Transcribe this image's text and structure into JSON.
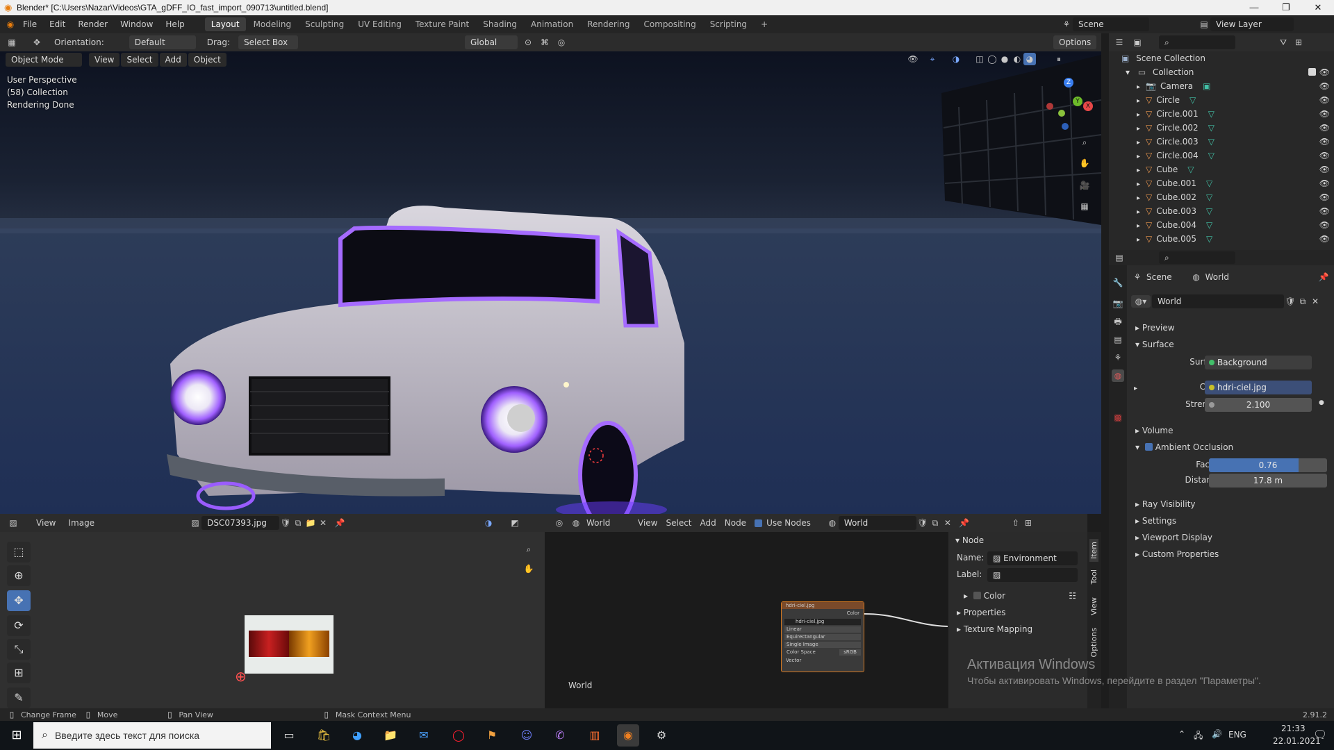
{
  "window": {
    "title": "Blender* [C:\\Users\\Nazar\\Videos\\GTA_gDFF_IO_fast_import_090713\\untitled.blend]",
    "minimize": "—",
    "maximize": "❐",
    "close": "✕"
  },
  "menu": [
    "File",
    "Edit",
    "Render",
    "Window",
    "Help"
  ],
  "workspaces": [
    "Layout",
    "Modeling",
    "Sculpting",
    "UV Editing",
    "Texture Paint",
    "Shading",
    "Animation",
    "Rendering",
    "Compositing",
    "Scripting"
  ],
  "active_workspace": "Layout",
  "scene_name": "Scene",
  "view_layer": "View Layer",
  "tool_header": {
    "orientation_label": "Orientation:",
    "orientation_value": "Default",
    "drag_label": "Drag:",
    "drag_value": "Select Box",
    "transform": "Global",
    "options": "Options"
  },
  "viewport_header": {
    "mode": "Object Mode",
    "view": "View",
    "select": "Select",
    "add": "Add",
    "object": "Object"
  },
  "viewport_overlay": {
    "line1": "User Perspective",
    "line2": "(58) Collection",
    "line3": "Rendering Done"
  },
  "gizmo": {
    "z": "Z",
    "y": "Y",
    "x": "X"
  },
  "outliner": {
    "root": "Scene Collection",
    "collection": "Collection",
    "items": [
      {
        "name": "Camera",
        "type": "camera"
      },
      {
        "name": "Circle",
        "type": "mesh"
      },
      {
        "name": "Circle.001",
        "type": "mesh"
      },
      {
        "name": "Circle.002",
        "type": "mesh"
      },
      {
        "name": "Circle.003",
        "type": "mesh"
      },
      {
        "name": "Circle.004",
        "type": "mesh"
      },
      {
        "name": "Cube",
        "type": "mesh"
      },
      {
        "name": "Cube.001",
        "type": "mesh"
      },
      {
        "name": "Cube.002",
        "type": "mesh"
      },
      {
        "name": "Cube.003",
        "type": "mesh"
      },
      {
        "name": "Cube.004",
        "type": "mesh"
      },
      {
        "name": "Cube.005",
        "type": "mesh"
      }
    ]
  },
  "properties": {
    "breadcrumb_scene": "Scene",
    "breadcrumb_world": "World",
    "world_name": "World",
    "sections": {
      "preview": "Preview",
      "surface": "Surface",
      "volume": "Volume",
      "ao": "Ambient Occlusion",
      "ray": "Ray Visibility",
      "settings": "Settings",
      "viewport_display": "Viewport Display",
      "custom": "Custom Properties"
    },
    "surface_label": "Surface",
    "surface_value": "Background",
    "color_label": "Color",
    "color_value": "hdri-ciel.jpg",
    "strength_label": "Strength",
    "strength_value": "2.100",
    "factor_label": "Factor",
    "factor_value": "0.76",
    "factor_fill": 0.76,
    "distance_label": "Distance",
    "distance_value": "17.8 m"
  },
  "image_editor": {
    "view": "View",
    "image": "Image",
    "filename": "DSC07393.jpg"
  },
  "node_editor": {
    "world": "World",
    "view": "View",
    "select": "Select",
    "add": "Add",
    "node": "Node",
    "use_nodes": "Use Nodes",
    "world_name": "World",
    "canvas_label": "World",
    "node_title": "hdri-ciel.jpg",
    "node_out": "Color",
    "node_img": "hdri-ciel.jpg",
    "node_r1": "Linear",
    "node_r2": "Equirectangular",
    "node_r3": "Single Image",
    "node_cs_label": "Color Space",
    "node_cs": "sRGB",
    "node_vec": "Vector"
  },
  "node_sidebar": {
    "section": "Node",
    "name_label": "Name:",
    "name_value": "Environment Texture",
    "label_label": "Label:",
    "color": "Color",
    "properties": "Properties",
    "texture_mapping": "Texture Mapping",
    "tabs": [
      "Item",
      "Tool",
      "View",
      "Options"
    ]
  },
  "activation": {
    "line1": "Активация Windows",
    "line2": "Чтобы активировать Windows, перейдите в раздел \"Параметры\"."
  },
  "status": {
    "change_frame": "Change Frame",
    "move": "Move",
    "pan_view": "Pan View",
    "mask_menu": "Mask Context Menu",
    "version": "2.91.2"
  },
  "taskbar": {
    "search": "Введите здесь текст для поиска",
    "lang": "ENG",
    "time": "21:33",
    "date": "22.01.2021"
  },
  "colors": {
    "accent": "#4772b3",
    "mesh_icon": "#e8964f",
    "teal": "#42c0a6"
  }
}
